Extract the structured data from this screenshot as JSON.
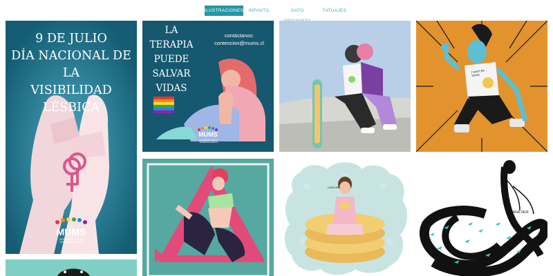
{
  "tabs": [
    {
      "label": "ILUSTRACIONES",
      "active": true
    },
    {
      "label": "INFANTIL",
      "active": false
    },
    {
      "label": "GATO OFICINISTA",
      "active": false
    },
    {
      "label": "TATUAJES",
      "active": false
    }
  ],
  "colors": {
    "accent": "#2596a5",
    "tab_text": "#49a7b7"
  },
  "gallery": {
    "poster_lesbian": {
      "title_lines": [
        "9 DE JULIO",
        "DÍA NACIONAL DE LA",
        "VISIBILIDAD LÉSBICA"
      ],
      "logo": "MUMS",
      "logo_sub_lines": [
        "MOVIMIENTO POR LA",
        "DIVERSIDAD SEXUAL"
      ]
    },
    "poster_therapy": {
      "title_lines": [
        "LA",
        "TERAPIA",
        "PUEDE",
        "SALVAR",
        "VIDAS"
      ],
      "contact_label": "contáctanos:",
      "contact_email": "contencion@mums.cl",
      "logo": "MUMS",
      "logo_sub_lines": [
        "MOVIMIENTO POR LA",
        "DIVERSIDAD SEXUAL"
      ]
    },
    "waffle_signature": "LANA.DEM",
    "hair_signature": "LANA.DEM",
    "skater_shirt_text": "I won't be home"
  }
}
